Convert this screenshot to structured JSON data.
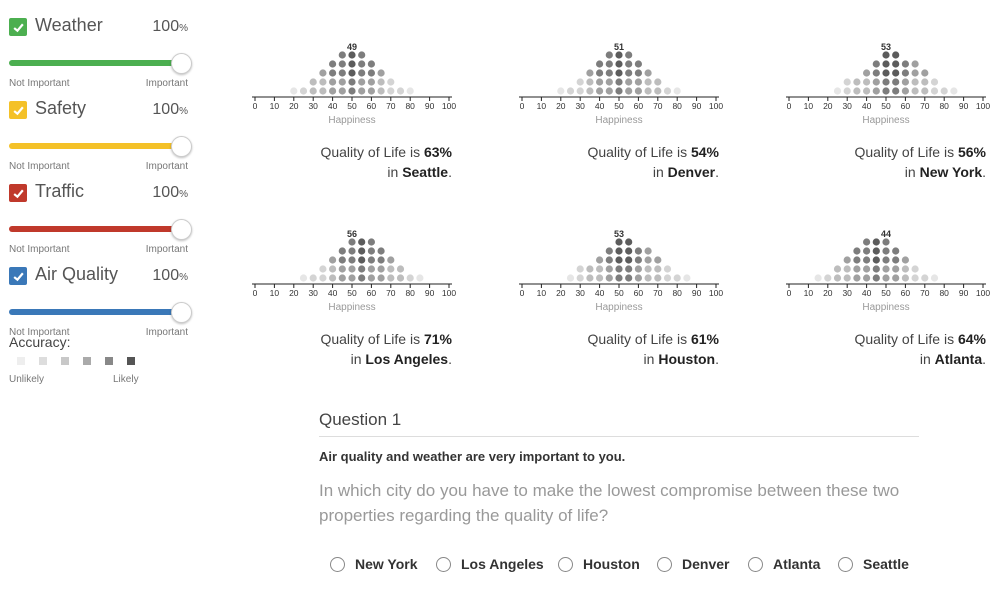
{
  "factors": [
    {
      "name": "Weather",
      "percent": "100",
      "unit": "%",
      "low_label": "Not Important",
      "high_label": "Important",
      "color": "#4caf50",
      "value": 1.0,
      "checked": true
    },
    {
      "name": "Safety",
      "percent": "100",
      "unit": "%",
      "low_label": "Not Important",
      "high_label": "Important",
      "color": "#f4c128",
      "value": 1.0,
      "checked": true
    },
    {
      "name": "Traffic",
      "percent": "100",
      "unit": "%",
      "low_label": "Not Important",
      "high_label": "Important",
      "color": "#c0392b",
      "value": 1.0,
      "checked": true
    },
    {
      "name": "Air Quality",
      "percent": "100",
      "unit": "%",
      "low_label": "Not Important",
      "high_label": "Important",
      "color": "#3a78b8",
      "value": 1.0,
      "checked": true
    }
  ],
  "accuracy": {
    "label": "Accuracy:",
    "low_label": "Unlikely",
    "high_label": "Likely",
    "levels": [
      "#eeeeee",
      "#dddddd",
      "#c8c8c8",
      "#aaaaaa",
      "#888888",
      "#555555"
    ]
  },
  "cities": [
    {
      "name": "Seattle",
      "peak_label": "49",
      "quality": "63",
      "prefix": "Quality of Life is ",
      "unit": "%",
      "in_text": "in ",
      "suffix": ".",
      "axis_label": "Happiness",
      "ticks": [
        "0",
        "10",
        "20",
        "30",
        "40",
        "50",
        "60",
        "70",
        "80",
        "90",
        "100"
      ]
    },
    {
      "name": "Denver",
      "peak_label": "51",
      "quality": "54",
      "prefix": "Quality of Life is ",
      "unit": "%",
      "in_text": "in ",
      "suffix": ".",
      "axis_label": "Happiness",
      "ticks": [
        "0",
        "10",
        "20",
        "30",
        "40",
        "50",
        "60",
        "70",
        "80",
        "90",
        "100"
      ]
    },
    {
      "name": "New York",
      "peak_label": "53",
      "quality": "56",
      "prefix": "Quality of Life is ",
      "unit": "%",
      "in_text": "in ",
      "suffix": ".",
      "axis_label": "Happiness",
      "ticks": [
        "0",
        "10",
        "20",
        "30",
        "40",
        "50",
        "60",
        "70",
        "80",
        "90",
        "100"
      ]
    },
    {
      "name": "Los Angeles",
      "peak_label": "56",
      "quality": "71",
      "prefix": "Quality of Life is ",
      "unit": "%",
      "in_text": "in ",
      "suffix": ".",
      "axis_label": "Happiness",
      "ticks": [
        "0",
        "10",
        "20",
        "30",
        "40",
        "50",
        "60",
        "70",
        "80",
        "90",
        "100"
      ]
    },
    {
      "name": "Houston",
      "peak_label": "53",
      "quality": "61",
      "prefix": "Quality of Life is ",
      "unit": "%",
      "in_text": "in ",
      "suffix": ".",
      "axis_label": "Happiness",
      "ticks": [
        "0",
        "10",
        "20",
        "30",
        "40",
        "50",
        "60",
        "70",
        "80",
        "90",
        "100"
      ]
    },
    {
      "name": "Atlanta",
      "peak_label": "44",
      "quality": "64",
      "prefix": "Quality of Life is ",
      "unit": "%",
      "in_text": "in ",
      "suffix": ".",
      "axis_label": "Happiness",
      "ticks": [
        "0",
        "10",
        "20",
        "30",
        "40",
        "50",
        "60",
        "70",
        "80",
        "90",
        "100"
      ]
    }
  ],
  "dot_columns": [
    [
      {
        "v": 15,
        "h": 1
      }
    ],
    [
      {
        "v": 25,
        "h": 2
      }
    ],
    [
      {
        "v": 30,
        "h": 3
      }
    ],
    [
      {
        "v": 40,
        "h": 4
      }
    ],
    [
      {
        "v": 45,
        "h": 5
      }
    ],
    [
      {
        "v": 50,
        "h": 5
      }
    ],
    [
      {
        "v": 55,
        "h": 5
      }
    ],
    [
      {
        "v": 60,
        "h": 4
      }
    ],
    [
      {
        "v": 70,
        "h": 3
      }
    ],
    [
      {
        "v": 80,
        "h": 2
      }
    ]
  ],
  "question": {
    "title": "Question 1",
    "bold": "Air quality and weather are very important to you.",
    "text": "In which city do you have to make the lowest compromise between these two properties regarding the quality of life?",
    "options": [
      "New York",
      "Los Angeles",
      "Houston",
      "Denver",
      "Atlanta",
      "Seattle"
    ]
  }
}
